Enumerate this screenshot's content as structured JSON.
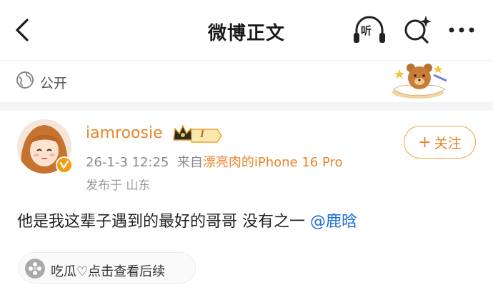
{
  "header": {
    "title": "微博正文",
    "listen_label": "听"
  },
  "visibility": {
    "label": "公开"
  },
  "post": {
    "author": {
      "username": "iamroosie",
      "level": "I"
    },
    "timestamp": "26-1-3 12:25",
    "source_prefix": "来自",
    "source": "漂亮肉的iPhone 16 Pro",
    "location": "发布于 山东",
    "text": "他是我这辈子遇到的最好的哥哥 没有之一",
    "mention": "@鹿晗",
    "follow_label": "关注",
    "follow_plus": "+",
    "topic_chip": "吃瓜♡点击查看后续"
  },
  "colors": {
    "accent_orange": "#e8852a",
    "mention_blue": "#1e6fd9"
  }
}
